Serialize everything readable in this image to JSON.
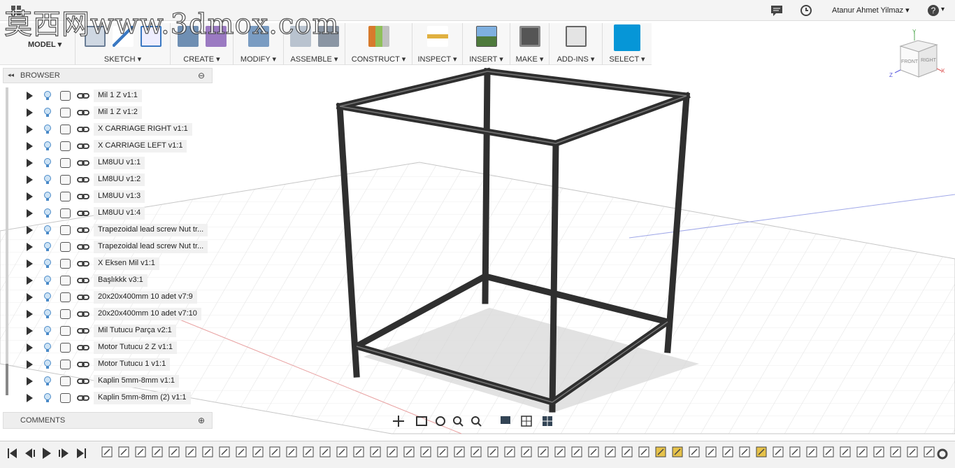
{
  "watermark": "莫西网www.3dmox.com",
  "topbar": {
    "user_name": "Atanur Ahmet Yilmaz"
  },
  "toolbar": {
    "workspace": "MODEL",
    "groups": [
      "SKETCH",
      "CREATE",
      "MODIFY",
      "ASSEMBLE",
      "CONSTRUCT",
      "INSPECT",
      "INSERT",
      "MAKE",
      "ADD-INS",
      "SELECT"
    ]
  },
  "browser": {
    "title": "BROWSER",
    "items": [
      {
        "label": "Mil 1 Z v1:1"
      },
      {
        "label": "Mil 1 Z v1:2"
      },
      {
        "label": "X CARRIAGE RIGHT v1:1"
      },
      {
        "label": "X CARRIAGE LEFT v1:1"
      },
      {
        "label": "LM8UU v1:1"
      },
      {
        "label": "LM8UU v1:2"
      },
      {
        "label": "LM8UU v1:3"
      },
      {
        "label": "LM8UU v1:4"
      },
      {
        "label": "Trapezoidal lead screw Nut tr..."
      },
      {
        "label": "Trapezoidal lead screw Nut tr..."
      },
      {
        "label": "X Eksen Mil v1:1"
      },
      {
        "label": "Başlıkkk v3:1"
      },
      {
        "label": "20x20x400mm 10 adet v7:9"
      },
      {
        "label": "20x20x400mm 10 adet v7:10"
      },
      {
        "label": "Mil Tutucu Parça v2:1"
      },
      {
        "label": "Motor Tutucu 2 Z v1:1"
      },
      {
        "label": "Motor Tutucu 1 v1:1"
      },
      {
        "label": "Kaplin 5mm-8mm v1:1"
      },
      {
        "label": "Kaplin 5mm-8mm (2) v1:1"
      }
    ]
  },
  "comments": {
    "title": "COMMENTS"
  },
  "viewcube": {
    "front": "FRONT",
    "right": "RIGHT",
    "axis_x": "X",
    "axis_y": "Y",
    "axis_z": "Z"
  },
  "colors": {
    "accent": "#0696d7",
    "frame": "#3a3a3a"
  }
}
